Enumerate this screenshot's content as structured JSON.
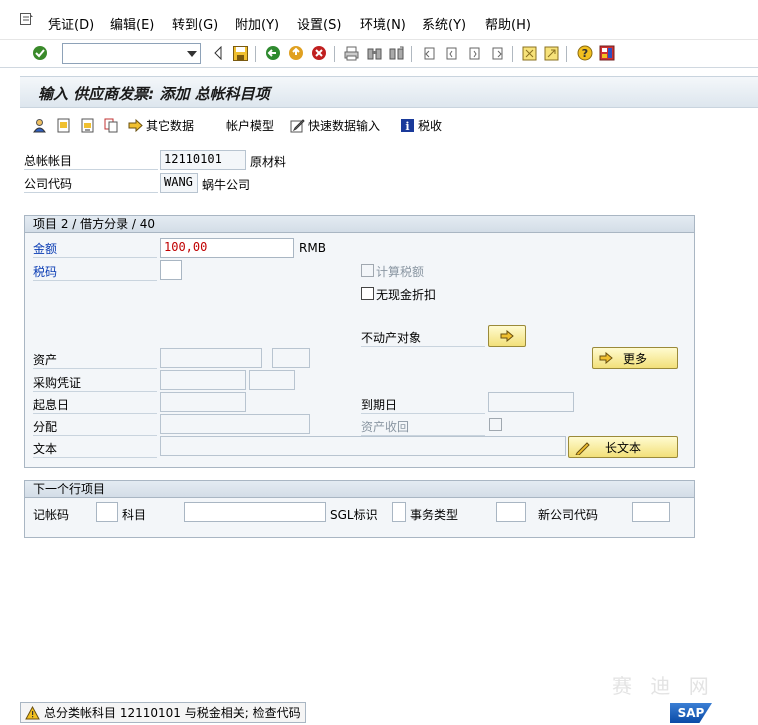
{
  "menu": {
    "items": [
      "凭证(D)",
      "编辑(E)",
      "转到(G)",
      "附加(Y)",
      "设置(S)",
      "环境(N)",
      "系统(Y)",
      "帮助(H)"
    ]
  },
  "toolbar": {
    "command_value": "",
    "icons": [
      "enter-icon",
      "back-icon",
      "save-icon",
      "back-green-icon",
      "exit-icon",
      "cancel-icon",
      "print-icon",
      "find-icon",
      "find-next-icon",
      "first-page-icon",
      "prev-page-icon",
      "next-page-icon",
      "last-page-icon",
      "create-session-icon",
      "shortcut-icon",
      "help-icon",
      "layout-icon"
    ]
  },
  "title": "输入 供应商发票: 添加 总帐科目项",
  "app_toolbar": {
    "other_data": "其它数据",
    "account_model": "帐户模型",
    "fast_entry": "快速数据输入",
    "tax": "税收"
  },
  "header": {
    "gl_account_label": "总帐帐目",
    "gl_account_value": "12110101",
    "gl_account_text": "原材料",
    "company_code_label": "公司代码",
    "company_code_value": "WANG",
    "company_code_text": "蜗牛公司"
  },
  "item_group": {
    "title": "项目 2 / 借方分录 / 40",
    "amount_label": "金额",
    "amount_value": "100,00",
    "currency": "RMB",
    "tax_code_label": "税码",
    "tax_code_value": "",
    "calc_tax_label": "计算税额",
    "no_discount_label": "无现金折扣",
    "real_estate_label": "不动产对象",
    "more_button": "更多",
    "asset_label": "资产",
    "purchase_doc_label": "采购凭证",
    "value_date_label": "起息日",
    "due_date_label": "到期日",
    "assignment_label": "分配",
    "asset_retirement_label": "资产收回",
    "text_label": "文本",
    "long_text_button": "长文本"
  },
  "next_item_group": {
    "title": "下一个行项目",
    "posting_key_label": "记帐码",
    "account_label": "科目",
    "sgl_label": "SGL标识",
    "trans_type_label": "事务类型",
    "new_company_label": "新公司代码"
  },
  "status": {
    "message": "总分类帐科目 12110101 与税金相关; 检查代码"
  },
  "logo_text": "SAP",
  "watermark": "赛 迪 网",
  "colors": {
    "accent_blue": "#0a3cb4",
    "amount_red": "#c00000",
    "button_yellow": "#f2e07a"
  }
}
